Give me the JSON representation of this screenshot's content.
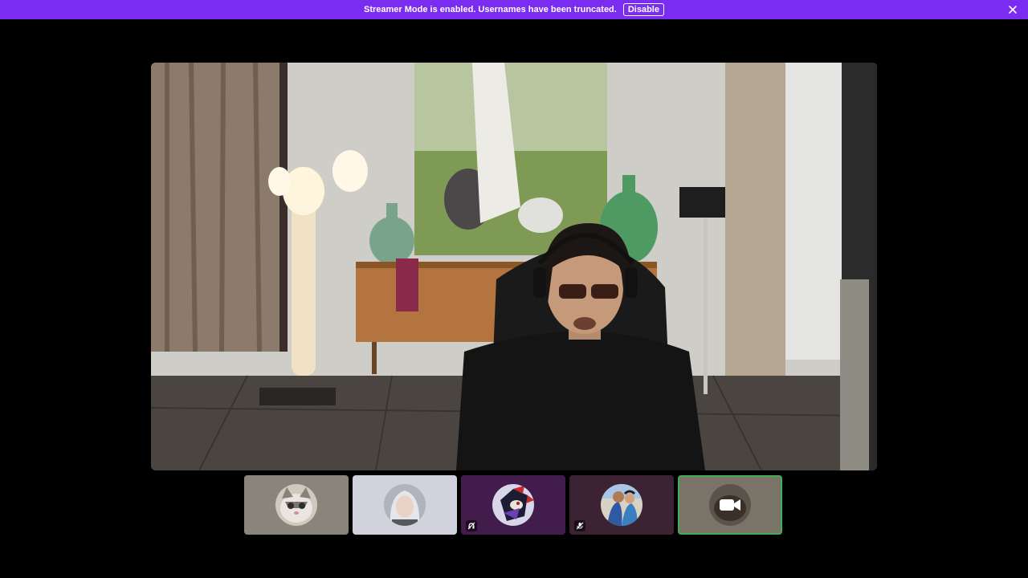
{
  "banner": {
    "message": "Streamer Mode is enabled. Usernames have been truncated.",
    "disable_label": "Disable",
    "background": "#7b2cf1"
  },
  "stage": {
    "content": "Live camera feed of participant"
  },
  "participants": [
    {
      "avatar": "cat-avatar",
      "tile_color": "#8a847b",
      "status": ""
    },
    {
      "avatar": "white-haired-woman-avatar",
      "tile_color": "#d1d2db",
      "status": ""
    },
    {
      "avatar": "hedgehog-avatar",
      "tile_color": "#421c4b",
      "status": "deafened-icon"
    },
    {
      "avatar": "couple-avatar",
      "tile_color": "#3c2334",
      "status": "muted-icon"
    },
    {
      "avatar": "video-camera-icon",
      "tile_color": "#7a7468",
      "status": "",
      "selected": true
    }
  ],
  "colors": {
    "selected_border": "#3fae55",
    "background": "#000000"
  }
}
